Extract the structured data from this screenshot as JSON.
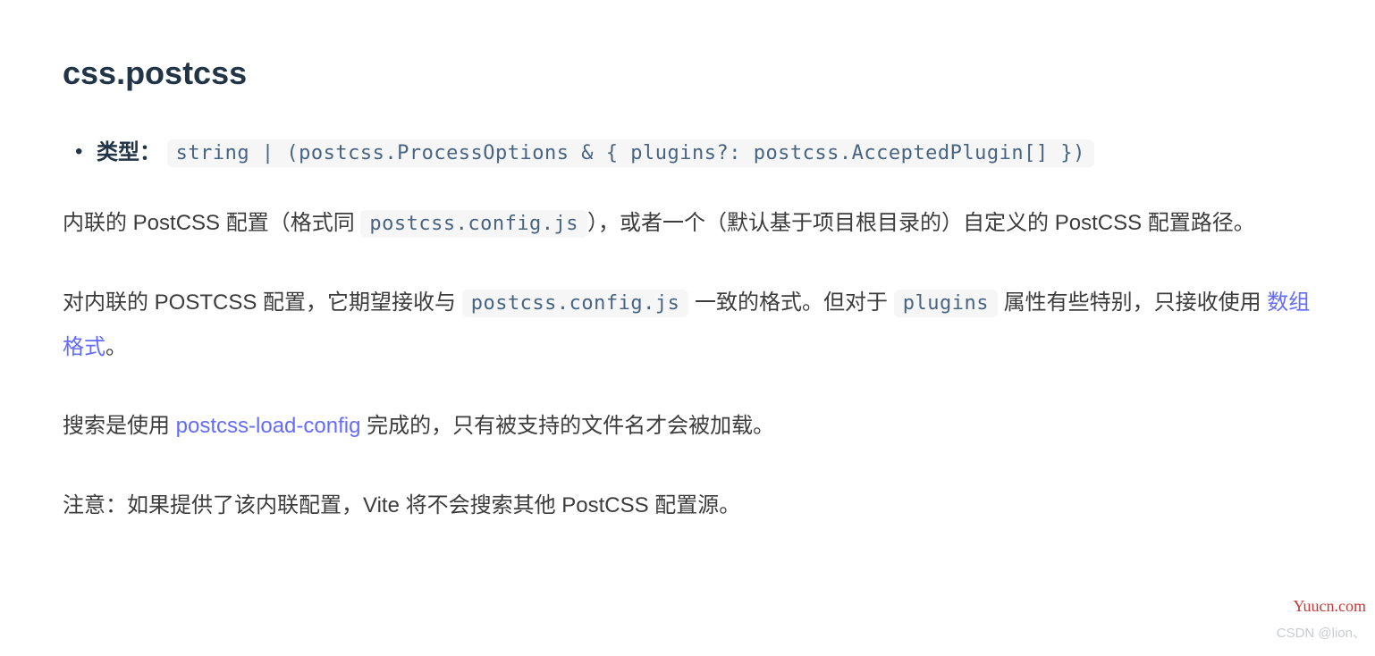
{
  "heading": "css.postcss",
  "typeLabel": "类型：",
  "typeCode": "string | (postcss.ProcessOptions & { plugins?: postcss.AcceptedPlugin[] })",
  "para1": {
    "t1": "内联的 PostCSS 配置（格式同 ",
    "code1": "postcss.config.js",
    "t2": "），或者一个（默认基于项目根目录的）自定义的 PostCSS 配置路径。"
  },
  "para2": {
    "t1": "对内联的 POSTCSS 配置，它期望接收与 ",
    "code1": "postcss.config.js",
    "t2": " 一致的格式。但对于 ",
    "code2": "plugins",
    "t3": " 属性有些特别，只接收使用 ",
    "link": "数组格式",
    "t4": "。"
  },
  "para3": {
    "t1": "搜索是使用 ",
    "link": "postcss-load-config",
    "t2": " 完成的，只有被支持的文件名才会被加载。"
  },
  "para4": "注意：如果提供了该内联配置，Vite 将不会搜索其他 PostCSS 配置源。",
  "watermark1": "Yuucn.com",
  "watermark2": "CSDN @lion、"
}
